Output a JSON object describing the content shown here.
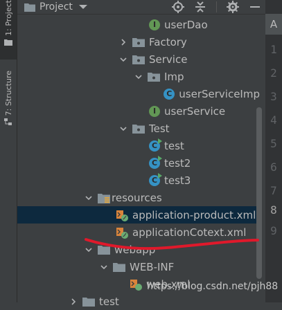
{
  "side_tabs": {
    "project": "1: Project",
    "structure": "7: Structure"
  },
  "panel": {
    "title": "Project"
  },
  "tree": [
    {
      "label": "userDao",
      "icon": "interface-icon",
      "badge": "I"
    },
    {
      "label": "Factory",
      "icon": "package-icon",
      "expanded": false
    },
    {
      "label": "Service",
      "icon": "package-icon",
      "expanded": true
    },
    {
      "label": "Imp",
      "icon": "package-icon",
      "expanded": true
    },
    {
      "label": "userServiceImp",
      "icon": "class-icon",
      "badge": "C"
    },
    {
      "label": "userService",
      "icon": "interface-icon",
      "badge": "I"
    },
    {
      "label": "Test",
      "icon": "package-icon",
      "expanded": true
    },
    {
      "label": "test",
      "icon": "class-run-icon",
      "badge": "C"
    },
    {
      "label": "test2",
      "icon": "class-run-icon",
      "badge": "C"
    },
    {
      "label": "test3",
      "icon": "class-run-icon",
      "badge": "C"
    },
    {
      "label": "resources",
      "icon": "resources-folder-icon",
      "expanded": true
    },
    {
      "label": "application-product.xml",
      "icon": "spring-xml-icon",
      "selected": true
    },
    {
      "label": "applicationCotext.xml",
      "icon": "spring-xml-icon"
    },
    {
      "label": "webapp",
      "icon": "folder-icon",
      "expanded": true
    },
    {
      "label": "WEB-INF",
      "icon": "folder-icon",
      "expanded": true
    },
    {
      "label": "web.xml",
      "icon": "xml-icon"
    },
    {
      "label": "test",
      "icon": "folder-icon",
      "expanded": false
    }
  ],
  "editor": {
    "tab_label": "A",
    "line_numbers": [
      "1",
      "2",
      "3",
      "4",
      "5",
      "6",
      "7",
      "8",
      "9"
    ],
    "current_line": "8"
  },
  "watermark": "https://blog.csdn.net/pjh88",
  "colors": {
    "background": "#3c3f41",
    "selection": "#0d293e",
    "annotation": "#e0192b",
    "interface": "#629755",
    "class": "#3592c4"
  }
}
